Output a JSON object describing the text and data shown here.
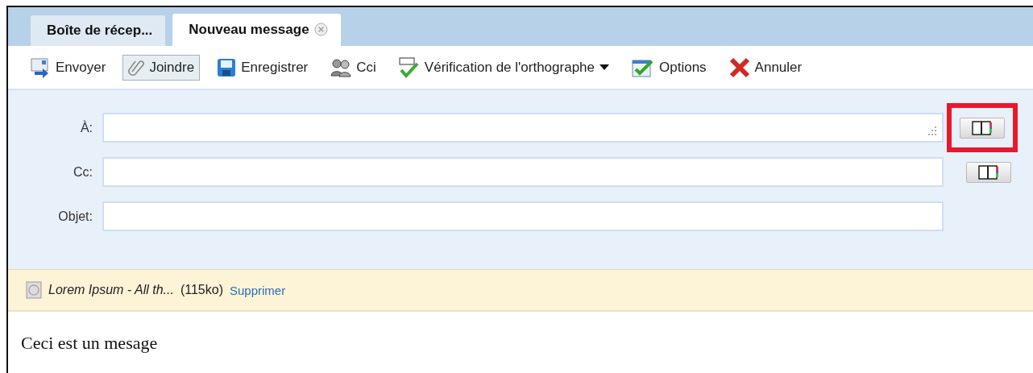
{
  "tabs": [
    {
      "label": "Boîte de récep...",
      "selected": false,
      "closable": false
    },
    {
      "label": "Nouveau message",
      "selected": true,
      "closable": true
    }
  ],
  "toolbar": [
    {
      "label": "Envoyer",
      "kind": "send",
      "pressed": false,
      "dropdown": false
    },
    {
      "label": "Joindre",
      "kind": "clip",
      "pressed": true,
      "dropdown": false
    },
    {
      "label": "Enregistrer",
      "kind": "save",
      "pressed": false,
      "dropdown": false
    },
    {
      "label": "Cci",
      "kind": "people",
      "pressed": false,
      "dropdown": false
    },
    {
      "label": "Vérification de l'orthographe",
      "kind": "spell",
      "pressed": false,
      "dropdown": true
    },
    {
      "label": "Options",
      "kind": "options",
      "pressed": false,
      "dropdown": false
    },
    {
      "label": "Annuler",
      "kind": "cancel",
      "pressed": false,
      "dropdown": false
    }
  ],
  "fields": [
    {
      "label": "À:",
      "address_book": true,
      "highlighted": true,
      "resizable": true
    },
    {
      "label": "Cc:",
      "address_book": true,
      "highlighted": false,
      "resizable": false
    },
    {
      "label": "Objet:",
      "address_book": false,
      "highlighted": false,
      "resizable": false
    }
  ],
  "attachment": {
    "name": "Lorem Ipsum - All th...",
    "size": "(115ko)",
    "link": "Supprimer"
  },
  "body": "Ceci est un mesage"
}
